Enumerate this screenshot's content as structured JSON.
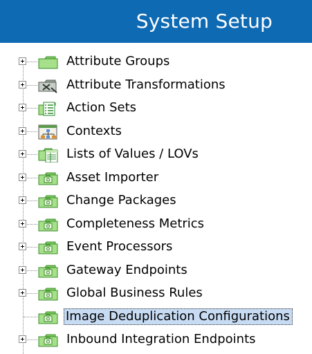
{
  "header": {
    "title": "System Setup",
    "color": "#0f6ab4"
  },
  "tree": {
    "items": [
      {
        "label": "Attribute Groups",
        "icon": "folder-icon",
        "expandable": true,
        "selected": false
      },
      {
        "label": "Attribute Transformations",
        "icon": "attribute-transformation-icon",
        "expandable": true,
        "selected": false
      },
      {
        "label": "Action Sets",
        "icon": "action-set-icon",
        "expandable": true,
        "selected": false
      },
      {
        "label": "Contexts",
        "icon": "context-hierarchy-icon",
        "expandable": true,
        "selected": false
      },
      {
        "label": "Lists of Values / LOVs",
        "icon": "list-of-values-icon",
        "expandable": true,
        "selected": false
      },
      {
        "label": "Asset Importer",
        "icon": "setup-folder-icon",
        "expandable": true,
        "selected": false
      },
      {
        "label": "Change Packages",
        "icon": "setup-folder-icon",
        "expandable": true,
        "selected": false
      },
      {
        "label": "Completeness Metrics",
        "icon": "setup-folder-icon",
        "expandable": true,
        "selected": false
      },
      {
        "label": "Event Processors",
        "icon": "setup-folder-icon",
        "expandable": true,
        "selected": false
      },
      {
        "label": "Gateway Endpoints",
        "icon": "setup-folder-icon",
        "expandable": true,
        "selected": false
      },
      {
        "label": "Global Business Rules",
        "icon": "setup-folder-icon",
        "expandable": true,
        "selected": false
      },
      {
        "label": "Image Deduplication Configurations",
        "icon": "setup-folder-icon",
        "expandable": false,
        "selected": true
      },
      {
        "label": "Inbound Integration Endpoints",
        "icon": "setup-folder-icon",
        "expandable": true,
        "selected": false
      }
    ]
  },
  "colors": {
    "selection": "#c7dbf3",
    "folder_green": "#a6e08a"
  }
}
